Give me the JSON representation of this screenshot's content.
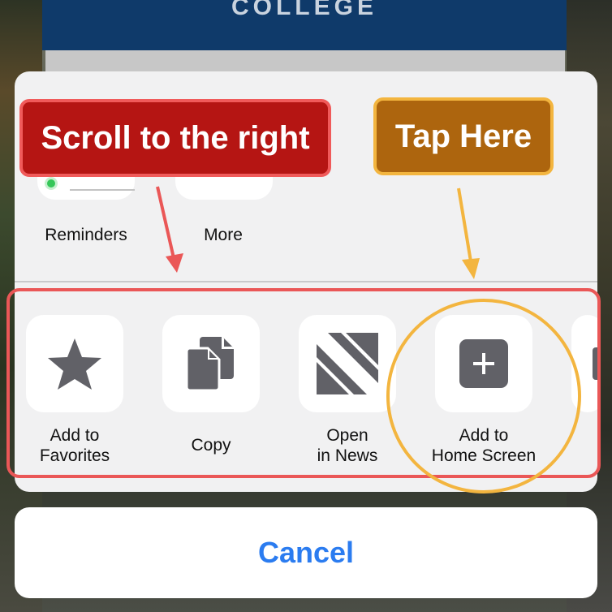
{
  "background": {
    "banner_text": "COLLEGE"
  },
  "share_sheet": {
    "top_row": [
      {
        "label": "Reminders",
        "icon": "reminders-icon"
      },
      {
        "label": "More",
        "icon": "more-icon"
      }
    ],
    "actions": [
      {
        "label_line1": "Add to",
        "label_line2": "Favorites",
        "icon": "star-icon"
      },
      {
        "label_line1": "Copy",
        "label_line2": "",
        "icon": "copy-icon"
      },
      {
        "label_line1": "Open",
        "label_line2": "in News",
        "icon": "news-icon"
      },
      {
        "label_line1": "Add to",
        "label_line2": "Home Screen",
        "icon": "plus-square-icon"
      }
    ]
  },
  "cancel_label": "Cancel",
  "annotations": {
    "scroll_hint": "Scroll to the right",
    "tap_hint": "Tap Here",
    "colors": {
      "red": "#b51513",
      "red_outline": "#ea5757",
      "orange": "#ad650e",
      "orange_outline": "#f3b53f"
    }
  },
  "colors": {
    "sheet_background": "#f1f1f2",
    "cancel_text": "#2b7cf0",
    "icon_gray": "#616167"
  }
}
